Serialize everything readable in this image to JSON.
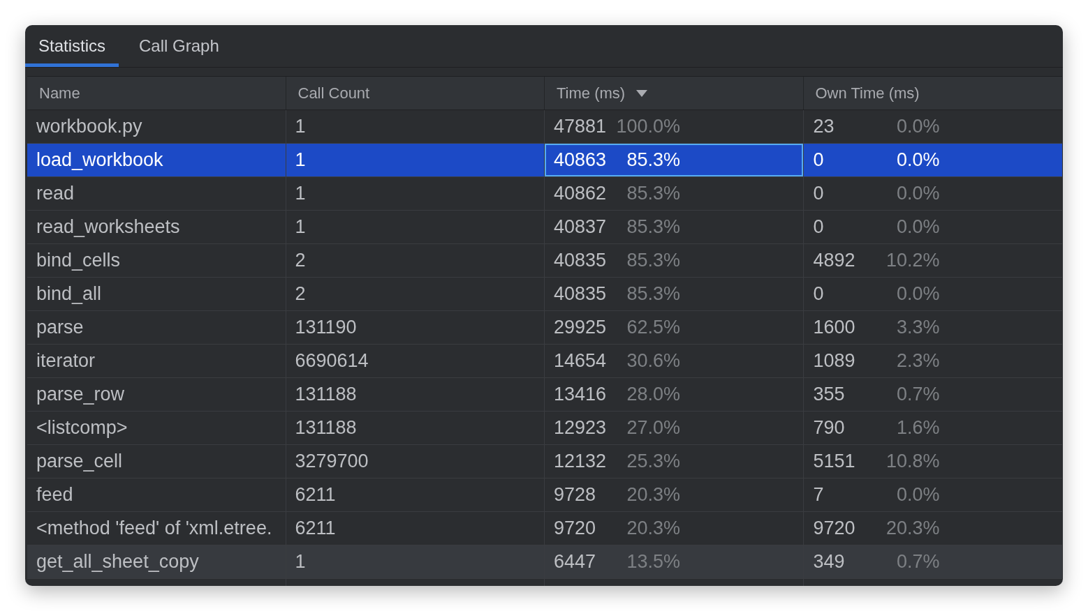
{
  "tabs": [
    {
      "label": "Statistics",
      "selected": true
    },
    {
      "label": "Call Graph",
      "selected": false
    }
  ],
  "table": {
    "columns": [
      {
        "label": "Name",
        "sorted": false
      },
      {
        "label": "Call Count",
        "sorted": false
      },
      {
        "label": "Time (ms)",
        "sorted": true
      },
      {
        "label": "Own Time (ms)",
        "sorted": false
      }
    ],
    "rows": [
      {
        "name": "workbook.py",
        "call_count": "1",
        "time": "47881",
        "time_percent": "100.0%",
        "own_time": "23",
        "own_time_percent": "0.0%",
        "selected": false,
        "hovered": false,
        "time_focused": false
      },
      {
        "name": "load_workbook",
        "call_count": "1",
        "time": "40863",
        "time_percent": "85.3%",
        "own_time": "0",
        "own_time_percent": "0.0%",
        "selected": true,
        "hovered": false,
        "time_focused": true
      },
      {
        "name": "read",
        "call_count": "1",
        "time": "40862",
        "time_percent": "85.3%",
        "own_time": "0",
        "own_time_percent": "0.0%",
        "selected": false,
        "hovered": false,
        "time_focused": false
      },
      {
        "name": "read_worksheets",
        "call_count": "1",
        "time": "40837",
        "time_percent": "85.3%",
        "own_time": "0",
        "own_time_percent": "0.0%",
        "selected": false,
        "hovered": false,
        "time_focused": false
      },
      {
        "name": "bind_cells",
        "call_count": "2",
        "time": "40835",
        "time_percent": "85.3%",
        "own_time": "4892",
        "own_time_percent": "10.2%",
        "selected": false,
        "hovered": false,
        "time_focused": false
      },
      {
        "name": "bind_all",
        "call_count": "2",
        "time": "40835",
        "time_percent": "85.3%",
        "own_time": "0",
        "own_time_percent": "0.0%",
        "selected": false,
        "hovered": false,
        "time_focused": false
      },
      {
        "name": "parse",
        "call_count": "131190",
        "time": "29925",
        "time_percent": "62.5%",
        "own_time": "1600",
        "own_time_percent": "3.3%",
        "selected": false,
        "hovered": false,
        "time_focused": false
      },
      {
        "name": "iterator",
        "call_count": "6690614",
        "time": "14654",
        "time_percent": "30.6%",
        "own_time": "1089",
        "own_time_percent": "2.3%",
        "selected": false,
        "hovered": false,
        "time_focused": false
      },
      {
        "name": "parse_row",
        "call_count": "131188",
        "time": "13416",
        "time_percent": "28.0%",
        "own_time": "355",
        "own_time_percent": "0.7%",
        "selected": false,
        "hovered": false,
        "time_focused": false
      },
      {
        "name": "<listcomp>",
        "call_count": "131188",
        "time": "12923",
        "time_percent": "27.0%",
        "own_time": "790",
        "own_time_percent": "1.6%",
        "selected": false,
        "hovered": false,
        "time_focused": false
      },
      {
        "name": "parse_cell",
        "call_count": "3279700",
        "time": "12132",
        "time_percent": "25.3%",
        "own_time": "5151",
        "own_time_percent": "10.8%",
        "selected": false,
        "hovered": false,
        "time_focused": false
      },
      {
        "name": "feed",
        "call_count": "6211",
        "time": "9728",
        "time_percent": "20.3%",
        "own_time": "7",
        "own_time_percent": "0.0%",
        "selected": false,
        "hovered": false,
        "time_focused": false
      },
      {
        "name": "<method 'feed' of 'xml.etree.",
        "call_count": "6211",
        "time": "9720",
        "time_percent": "20.3%",
        "own_time": "9720",
        "own_time_percent": "20.3%",
        "selected": false,
        "hovered": false,
        "time_focused": false
      },
      {
        "name": "get_all_sheet_copy",
        "call_count": "1",
        "time": "6447",
        "time_percent": "13.5%",
        "own_time": "349",
        "own_time_percent": "0.7%",
        "selected": false,
        "hovered": true,
        "time_focused": false
      }
    ]
  }
}
